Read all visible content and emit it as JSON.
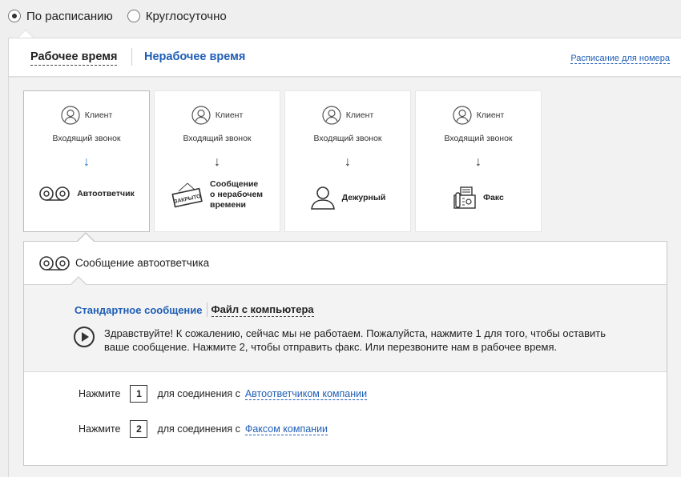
{
  "mode_options": [
    {
      "label": "По расписанию",
      "selected": true
    },
    {
      "label": "Круглосуточно",
      "selected": false
    }
  ],
  "tabs": {
    "working": "Рабочее время",
    "nonworking": "Нерабочее время"
  },
  "schedule_link": "Расписание для номера",
  "cards": [
    {
      "client": "Клиент",
      "incoming": "Входящий звонок",
      "arrow": "↓",
      "target_icon": "answering-machine-icon",
      "target": "Автоответчик",
      "selected": true
    },
    {
      "client": "Клиент",
      "incoming": "Входящий звонок",
      "arrow": "↓",
      "target_icon": "closed-sign-icon",
      "target_lines": [
        "Сообщение",
        "о нерабочем",
        "времени"
      ],
      "sign_text": "ЗАКРЫТО",
      "selected": false
    },
    {
      "client": "Клиент",
      "incoming": "Входящий звонок",
      "arrow": "↓",
      "target_icon": "person-icon",
      "target": "Дежурный",
      "selected": false
    },
    {
      "client": "Клиент",
      "incoming": "Входящий звонок",
      "arrow": "↓",
      "target_icon": "fax-icon",
      "target": "Факс",
      "selected": false
    }
  ],
  "detail": {
    "title": "Сообщение автоответчика",
    "msg_tabs": {
      "standard": "Стандартное сообщение",
      "file": "Файл с компьютера"
    },
    "message": "Здравствуйте! К сожалению, сейчас мы не работаем. Пожалуйста, нажмите 1 для того, чтобы оставить ваше сообщение. Нажмите 2, чтобы отправить факс. Или перезвоните нам в рабочее время.",
    "press_rows": [
      {
        "press": "Нажмите",
        "key": "1",
        "connect": "для соединения с",
        "link": "Автоответчиком компании"
      },
      {
        "press": "Нажмите",
        "key": "2",
        "connect": "для соединения с",
        "link": "Факсом компании"
      }
    ]
  },
  "colors": {
    "link": "#1f5eb6",
    "accent_arrow": "#1f6fc7",
    "background": "#efefef"
  }
}
